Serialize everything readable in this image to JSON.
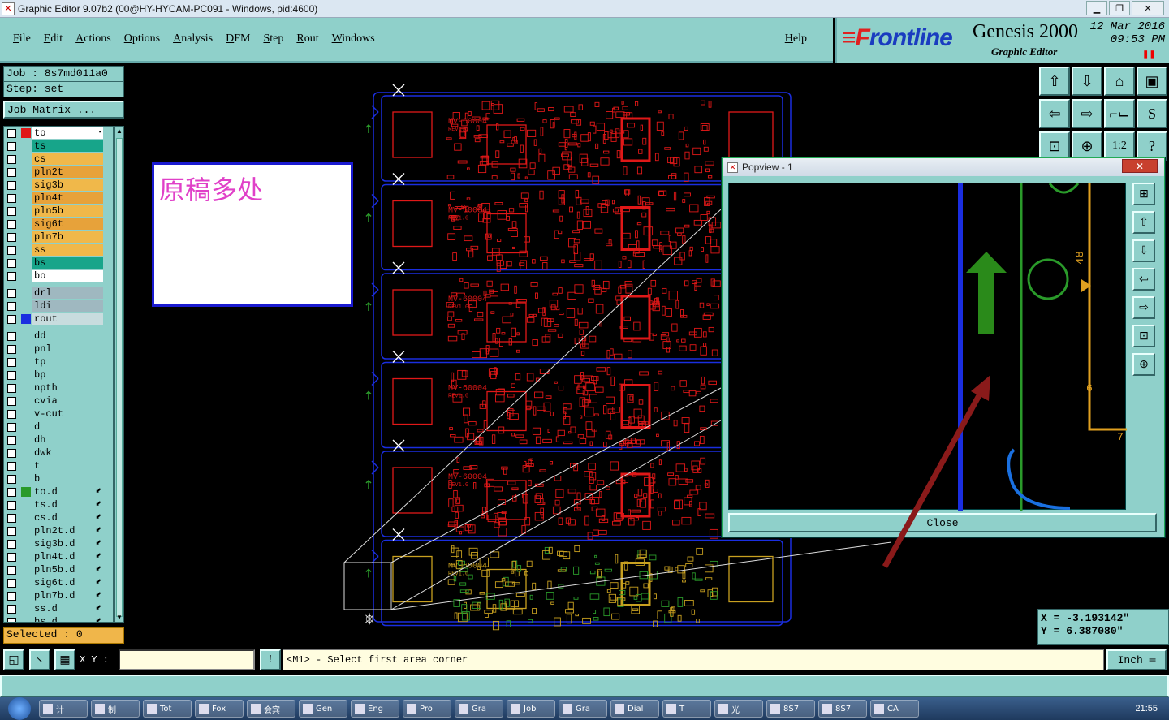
{
  "window": {
    "title": "Graphic Editor 9.07b2 (00@HY-HYCAM-PC091 - Windows, pid:4600)",
    "min": "▁",
    "max": "❐",
    "close": "✕"
  },
  "menu": {
    "items": [
      "File",
      "Edit",
      "Actions",
      "Options",
      "Analysis",
      "DFM",
      "Step",
      "Rout",
      "Windows"
    ],
    "help": "Help"
  },
  "brand": {
    "logo_a": "≡F",
    "logo_b": "rontline",
    "product": "Genesis 2000",
    "subtitle": "Graphic Editor",
    "date": "12 Mar 2016",
    "time": "09:53 PM",
    "pause": "❚❚"
  },
  "job": {
    "job_line": "Job : 8s7md011a0",
    "step_line": "Step: set",
    "matrix_button": "Job Matrix ..."
  },
  "layers": [
    {
      "name": "to",
      "color": "#e01818",
      "bg": "#ffffff",
      "group": 1,
      "flag": "▪"
    },
    {
      "name": "ts",
      "color": "",
      "bg": "#17a58a",
      "group": 1
    },
    {
      "name": "cs",
      "color": "",
      "bg": "#f0b84a",
      "group": 1
    },
    {
      "name": "pln2t",
      "color": "",
      "bg": "#e7a23a",
      "group": 1
    },
    {
      "name": "sig3b",
      "color": "",
      "bg": "#f0b84a",
      "group": 1
    },
    {
      "name": "pln4t",
      "color": "",
      "bg": "#e7a23a",
      "group": 1
    },
    {
      "name": "pln5b",
      "color": "",
      "bg": "#f0b84a",
      "group": 1
    },
    {
      "name": "sig6t",
      "color": "",
      "bg": "#e7a23a",
      "group": 1
    },
    {
      "name": "pln7b",
      "color": "",
      "bg": "#f0b84a",
      "group": 1
    },
    {
      "name": "ss",
      "color": "",
      "bg": "#f0b84a",
      "group": 1
    },
    {
      "name": "bs",
      "color": "",
      "bg": "#17a58a",
      "group": 1
    },
    {
      "name": "bo",
      "color": "",
      "bg": "#ffffff",
      "group": 1
    },
    {
      "name": "drl",
      "color": "",
      "bg": "#9fb8c0",
      "group": 2
    },
    {
      "name": "ldi",
      "color": "",
      "bg": "#9fb8c0",
      "group": 2
    },
    {
      "name": "rout",
      "color": "#1a2ee0",
      "bg": "#c8dcde",
      "group": 2
    },
    {
      "name": "dd",
      "color": "",
      "bg": "#8fd0ca",
      "group": 3
    },
    {
      "name": "pnl",
      "color": "",
      "bg": "#8fd0ca",
      "group": 3
    },
    {
      "name": "tp",
      "color": "",
      "bg": "#8fd0ca",
      "group": 3
    },
    {
      "name": "bp",
      "color": "",
      "bg": "#8fd0ca",
      "group": 3
    },
    {
      "name": "npth",
      "color": "",
      "bg": "#8fd0ca",
      "group": 3
    },
    {
      "name": "cvia",
      "color": "",
      "bg": "#8fd0ca",
      "group": 3
    },
    {
      "name": "v-cut",
      "color": "",
      "bg": "#8fd0ca",
      "group": 3
    },
    {
      "name": "d",
      "color": "",
      "bg": "#8fd0ca",
      "group": 3
    },
    {
      "name": "dh",
      "color": "",
      "bg": "#8fd0ca",
      "group": 3
    },
    {
      "name": "dwk",
      "color": "",
      "bg": "#8fd0ca",
      "group": 3
    },
    {
      "name": "t",
      "color": "",
      "bg": "#8fd0ca",
      "group": 3
    },
    {
      "name": "b",
      "color": "",
      "bg": "#8fd0ca",
      "group": 3
    },
    {
      "name": "to.d",
      "color": "#2a9a2a",
      "bg": "#8fd0ca",
      "group": 3,
      "flag": "⬋"
    },
    {
      "name": "ts.d",
      "color": "",
      "bg": "#8fd0ca",
      "group": 3,
      "flag": "⬋"
    },
    {
      "name": "cs.d",
      "color": "",
      "bg": "#8fd0ca",
      "group": 3,
      "flag": "⬋"
    },
    {
      "name": "pln2t.d",
      "color": "",
      "bg": "#8fd0ca",
      "group": 3,
      "flag": "⬋"
    },
    {
      "name": "sig3b.d",
      "color": "",
      "bg": "#8fd0ca",
      "group": 3,
      "flag": "⬋"
    },
    {
      "name": "pln4t.d",
      "color": "",
      "bg": "#8fd0ca",
      "group": 3,
      "flag": "⬋"
    },
    {
      "name": "pln5b.d",
      "color": "",
      "bg": "#8fd0ca",
      "group": 3,
      "flag": "⬋"
    },
    {
      "name": "sig6t.d",
      "color": "",
      "bg": "#8fd0ca",
      "group": 3,
      "flag": "⬋"
    },
    {
      "name": "pln7b.d",
      "color": "",
      "bg": "#8fd0ca",
      "group": 3,
      "flag": "⬋"
    },
    {
      "name": "ss.d",
      "color": "",
      "bg": "#8fd0ca",
      "group": 3,
      "flag": "⬋"
    },
    {
      "name": "bs.d",
      "color": "",
      "bg": "#8fd0ca",
      "group": 3,
      "flag": "⬋"
    }
  ],
  "selected": "Selected : 0",
  "note": {
    "text": "原稿多处"
  },
  "boards": {
    "label_top": "MV-60004",
    "label_bot": "REV1.0"
  },
  "popview": {
    "title": "Popview - 1",
    "close_icon": "✕",
    "close_button": "Close",
    "marks": [
      "4",
      "48",
      "6",
      "7"
    ]
  },
  "coords": {
    "x": "X = -3.193142\"",
    "y": "Y = 6.387080\""
  },
  "command": {
    "xy_label": "X Y :",
    "xy_value": "",
    "prompt": "<M1> - Select first area corner",
    "unit": "Inch ═"
  },
  "taskbar": {
    "items": [
      "计",
      "制",
      "Tot",
      "Fox",
      "会宾",
      "Gen",
      "Eng",
      "Pro",
      "Gra",
      "Job",
      "Gra",
      "Dial",
      "T",
      "光",
      "8S7",
      "8S7",
      "CA"
    ],
    "clock": "21:55"
  },
  "colors": {
    "accent": "#8fd0ca",
    "trace": "#e01818",
    "outline": "#1a2ee0",
    "arrow": "#2a8a1a"
  }
}
